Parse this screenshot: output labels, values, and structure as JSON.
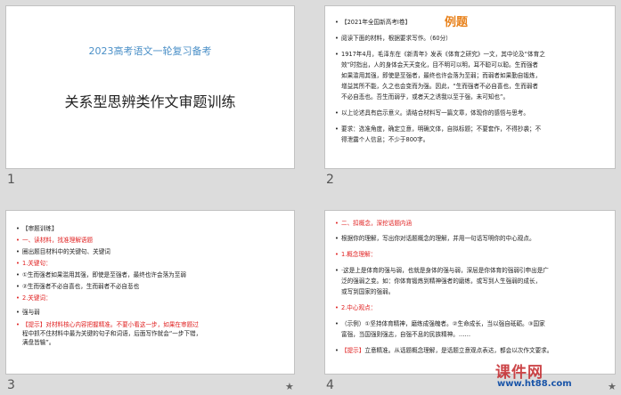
{
  "slides": [
    {
      "number": "1",
      "subtitle": "2023高考语文一轮复习备考",
      "title": "关系型思辨类作文审题训练"
    },
    {
      "number": "2",
      "badge": "例题",
      "lines": [
        "【2021年全国新高考Ⅰ卷】",
        "阅读下面的材料，根据要求写作。（60分）",
        "1917年4月，毛泽东在《新青年》发表《体育之研究》一文，其中论及“体育之",
        "效”时指出，人的身体会天天变化，目不明可以明，耳不聪可以聪。生而强者",
        "如果滥用其强，即使是至强者，最终也许会落为至弱；而弱者如果勤自锻炼，",
        "增益其所不能，久之也会变而为强。因此，“生而强者不必自喜也，生而弱者",
        "不必自悲也。吾生而弱乎，或者天之诱我以至于强，未可知也”。",
        "以上论述具有启示意义。请结合材料写一篇文章，体现你的感悟与思考。",
        "要求：选准角度，确定立意，明确文体，自拟标题；不要套作，不得抄袭；不",
        "得泄露个人信息；不少于800字。"
      ]
    },
    {
      "number": "3",
      "lines": [
        "【审题训练】",
        "一、读材料，找准理解语题",
        "圈出题目材料中的关键句、关键词",
        "1.关键句：",
        "①生而强者如果滥用其强，即使是至强者，最终也许会落为至弱",
        "②生而强者不必自喜也，生而弱者不必自悲也",
        "2.关键词：",
        "强与弱",
        "【提示】对材料核心内容把握精准。不要小看这一步，如果在审题过",
        "程中抓不住材料中最为关键的句子和词语，后面写作就会“一步下错，",
        "满盘皆输”。"
      ]
    },
    {
      "number": "4",
      "lines": [
        "二、扣概念，深挖话题内涵",
        "根据你的理解，写出你对话题概念的理解，并用一句话写明你的中心观点。",
        "1.概念理解：",
        "·这是上是体育的强与弱，也就是身体的强与弱，深层是你体育的强弱引申出是广",
        "泛的强弱之变。如：你体育锻炼到精神强者的磨练，或写到人生强弱的成长，",
        "或写到国家的强弱。",
        "2.中心观点：",
        "（示例）①坚持体育精神，磨练成强魄者。②生命成长，当以强自砥砺。③国家",
        "富强，当国强则强志，自强不息的民族精神。……",
        "【提示】立意精准。从话题概念理解，是话题立意观点表达，都会以次作文要求。"
      ]
    }
  ],
  "watermark": {
    "main": "课件网",
    "url": "www.ht88.com"
  }
}
